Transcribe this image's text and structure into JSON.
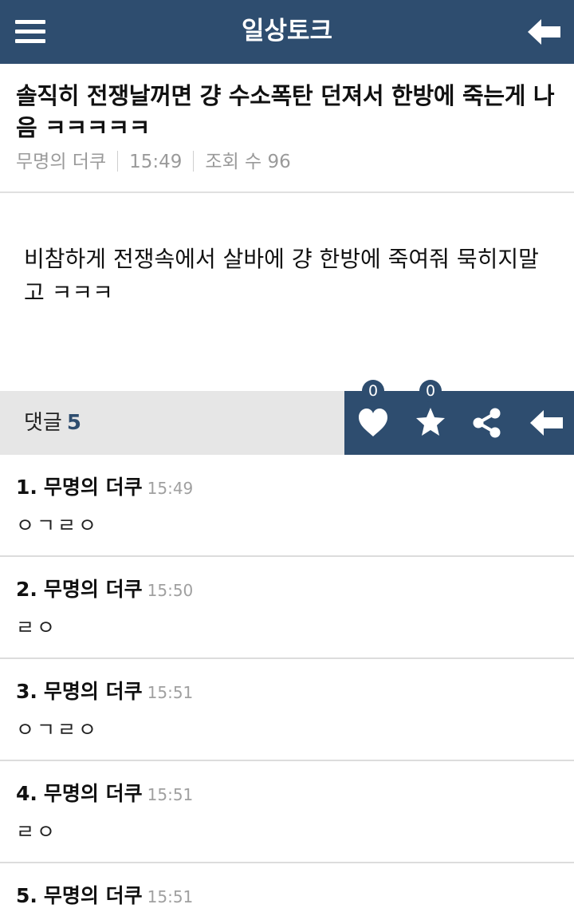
{
  "header": {
    "title": "일상토크",
    "menu_icon": "hamburger-menu-icon",
    "back_icon": "arrow-left-icon"
  },
  "post": {
    "title": "솔직히 전쟁날꺼면 걍 수소폭탄 던져서 한방에 죽는게 나음 ㅋㅋㅋㅋㅋ",
    "author": "무명의 더쿠",
    "time": "15:49",
    "views": "조회 수 96",
    "body": "비참하게 전쟁속에서 살바에 걍 한방에 죽여줘 묵히지말고 ㅋㅋㅋ"
  },
  "comment_bar": {
    "label": "댓글",
    "count": "5"
  },
  "actions": {
    "like_count": "0",
    "favorite_count": "0",
    "like_icon": "heart-icon",
    "favorite_icon": "star-icon",
    "share_icon": "share-icon",
    "back_icon": "arrow-left-icon"
  },
  "comments": [
    {
      "number": "1.",
      "author": "무명의 더쿠",
      "time": "15:49",
      "text": "ㅇㄱㄹㅇ"
    },
    {
      "number": "2.",
      "author": "무명의 더쿠",
      "time": "15:50",
      "text": "ㄹㅇ"
    },
    {
      "number": "3.",
      "author": "무명의 더쿠",
      "time": "15:51",
      "text": "ㅇㄱㄹㅇ"
    },
    {
      "number": "4.",
      "author": "무명의 더쿠",
      "time": "15:51",
      "text": "ㄹㅇ"
    },
    {
      "number": "5.",
      "author": "무명의 더쿠",
      "time": "15:51",
      "text": ""
    }
  ],
  "colors": {
    "primary": "#2e4d6f",
    "comment_bar_bg": "#e6e6e6",
    "meta_text": "#9a9a9a"
  }
}
